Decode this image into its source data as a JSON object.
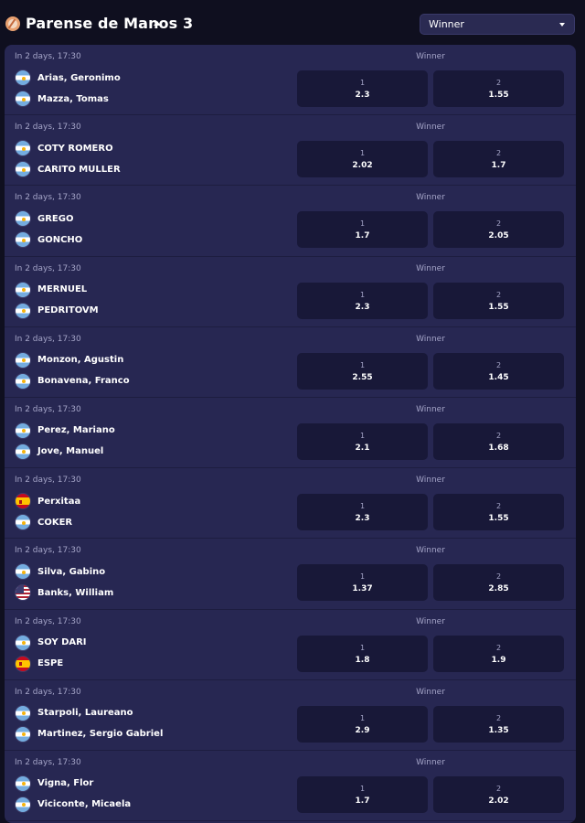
{
  "header": {
    "title": "Parense de Manos 3",
    "sport_icon": "table-tennis-icon",
    "market_select": {
      "value": "Winner"
    }
  },
  "colors": {
    "page_background": "#0f0f1f",
    "panel_background": "#272752",
    "odds_button": "#181838",
    "muted_text": "#a5a5c8"
  },
  "matches": [
    {
      "time": "In 2 days, 17:30",
      "market": "Winner",
      "home": {
        "name": "Arias, Geronimo",
        "flag": "ar"
      },
      "away": {
        "name": "Mazza, Tomas",
        "flag": "ar"
      },
      "odds": [
        {
          "label": "1",
          "value": "2.3"
        },
        {
          "label": "2",
          "value": "1.55"
        }
      ]
    },
    {
      "time": "In 2 days, 17:30",
      "market": "Winner",
      "home": {
        "name": "COTY ROMERO",
        "flag": "ar"
      },
      "away": {
        "name": "CARITO MULLER",
        "flag": "ar"
      },
      "odds": [
        {
          "label": "1",
          "value": "2.02"
        },
        {
          "label": "2",
          "value": "1.7"
        }
      ]
    },
    {
      "time": "In 2 days, 17:30",
      "market": "Winner",
      "home": {
        "name": "GREGO",
        "flag": "ar"
      },
      "away": {
        "name": "GONCHO",
        "flag": "ar"
      },
      "odds": [
        {
          "label": "1",
          "value": "1.7"
        },
        {
          "label": "2",
          "value": "2.05"
        }
      ]
    },
    {
      "time": "In 2 days, 17:30",
      "market": "Winner",
      "home": {
        "name": "MERNUEL",
        "flag": "ar"
      },
      "away": {
        "name": "PEDRITOVM",
        "flag": "ar"
      },
      "odds": [
        {
          "label": "1",
          "value": "2.3"
        },
        {
          "label": "2",
          "value": "1.55"
        }
      ]
    },
    {
      "time": "In 2 days, 17:30",
      "market": "Winner",
      "home": {
        "name": "Monzon, Agustin",
        "flag": "ar"
      },
      "away": {
        "name": "Bonavena, Franco",
        "flag": "ar"
      },
      "odds": [
        {
          "label": "1",
          "value": "2.55"
        },
        {
          "label": "2",
          "value": "1.45"
        }
      ]
    },
    {
      "time": "In 2 days, 17:30",
      "market": "Winner",
      "home": {
        "name": "Perez, Mariano",
        "flag": "ar"
      },
      "away": {
        "name": "Jove, Manuel",
        "flag": "ar"
      },
      "odds": [
        {
          "label": "1",
          "value": "2.1"
        },
        {
          "label": "2",
          "value": "1.68"
        }
      ]
    },
    {
      "time": "In 2 days, 17:30",
      "market": "Winner",
      "home": {
        "name": "Perxitaa",
        "flag": "es"
      },
      "away": {
        "name": "COKER",
        "flag": "ar"
      },
      "odds": [
        {
          "label": "1",
          "value": "2.3"
        },
        {
          "label": "2",
          "value": "1.55"
        }
      ]
    },
    {
      "time": "In 2 days, 17:30",
      "market": "Winner",
      "home": {
        "name": "Silva, Gabino",
        "flag": "ar"
      },
      "away": {
        "name": "Banks, William",
        "flag": "us"
      },
      "odds": [
        {
          "label": "1",
          "value": "1.37"
        },
        {
          "label": "2",
          "value": "2.85"
        }
      ]
    },
    {
      "time": "In 2 days, 17:30",
      "market": "Winner",
      "home": {
        "name": "SOY DARI",
        "flag": "ar"
      },
      "away": {
        "name": "ESPE",
        "flag": "es"
      },
      "odds": [
        {
          "label": "1",
          "value": "1.8"
        },
        {
          "label": "2",
          "value": "1.9"
        }
      ]
    },
    {
      "time": "In 2 days, 17:30",
      "market": "Winner",
      "home": {
        "name": "Starpoli, Laureano",
        "flag": "ar"
      },
      "away": {
        "name": "Martinez, Sergio Gabriel",
        "flag": "ar"
      },
      "odds": [
        {
          "label": "1",
          "value": "2.9"
        },
        {
          "label": "2",
          "value": "1.35"
        }
      ]
    },
    {
      "time": "In 2 days, 17:30",
      "market": "Winner",
      "home": {
        "name": "Vigna, Flor",
        "flag": "ar"
      },
      "away": {
        "name": "Viciconte, Micaela",
        "flag": "ar"
      },
      "odds": [
        {
          "label": "1",
          "value": "1.7"
        },
        {
          "label": "2",
          "value": "2.02"
        }
      ]
    }
  ]
}
